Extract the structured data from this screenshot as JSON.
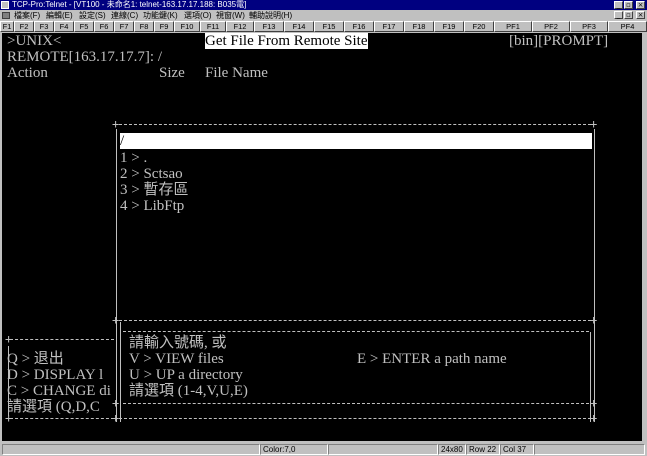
{
  "window": {
    "title": "TCP-Pro:Telnet - [VT100 - 未命名1: telnet-163.17.17.188: B035電]",
    "minimize": "_",
    "maximize": "▫",
    "close": "×",
    "doc_minimize": "_",
    "doc_maximize": "▫",
    "doc_close": "×"
  },
  "menubar": {
    "items": [
      "檔案(F)",
      "編輯(E)",
      "設定(S)",
      "連線(C)",
      "功能鍵(K)",
      "選項(O)",
      "視窗(W)",
      "輔助說明(H)"
    ]
  },
  "fkeys": [
    "F1",
    "F2",
    "F3",
    "F4",
    "F5",
    "F6",
    "F7",
    "F8",
    "F9",
    "F10",
    "F11",
    "F12",
    "F13",
    "F14",
    "F15",
    "F16",
    "F17",
    "F18",
    "F19",
    "F20",
    "PF1",
    "PF2",
    "PF3",
    "PF4"
  ],
  "terminal": {
    "system": ">UNIX<",
    "heading": "Get File From Remote Site",
    "mode": "[bin][PROMPT]",
    "remote": "REMOTE[163.17.17.7]: /",
    "col_action": "Action",
    "col_size": "Size",
    "col_filename": "File Name",
    "path_input": "/",
    "entries": [
      "1 > .",
      "2 > Sctsao",
      "3 > 暫存區",
      "4 > LibFtp"
    ],
    "left_menu": [
      "Q > 退出",
      "D > DISPLAY l",
      "C > CHANGE di",
      "請選項 (Q,D,C"
    ],
    "prompt_lines": [
      "請輸入號碼, 或",
      "V > VIEW files",
      "U > UP a directory",
      "請選項 (1-4,V,U,E)"
    ],
    "enter_option": "E > ENTER a path name"
  },
  "statusbar": {
    "color": "Color:7,0",
    "size": "24x80",
    "row": "Row 22",
    "col": "Col 37"
  }
}
